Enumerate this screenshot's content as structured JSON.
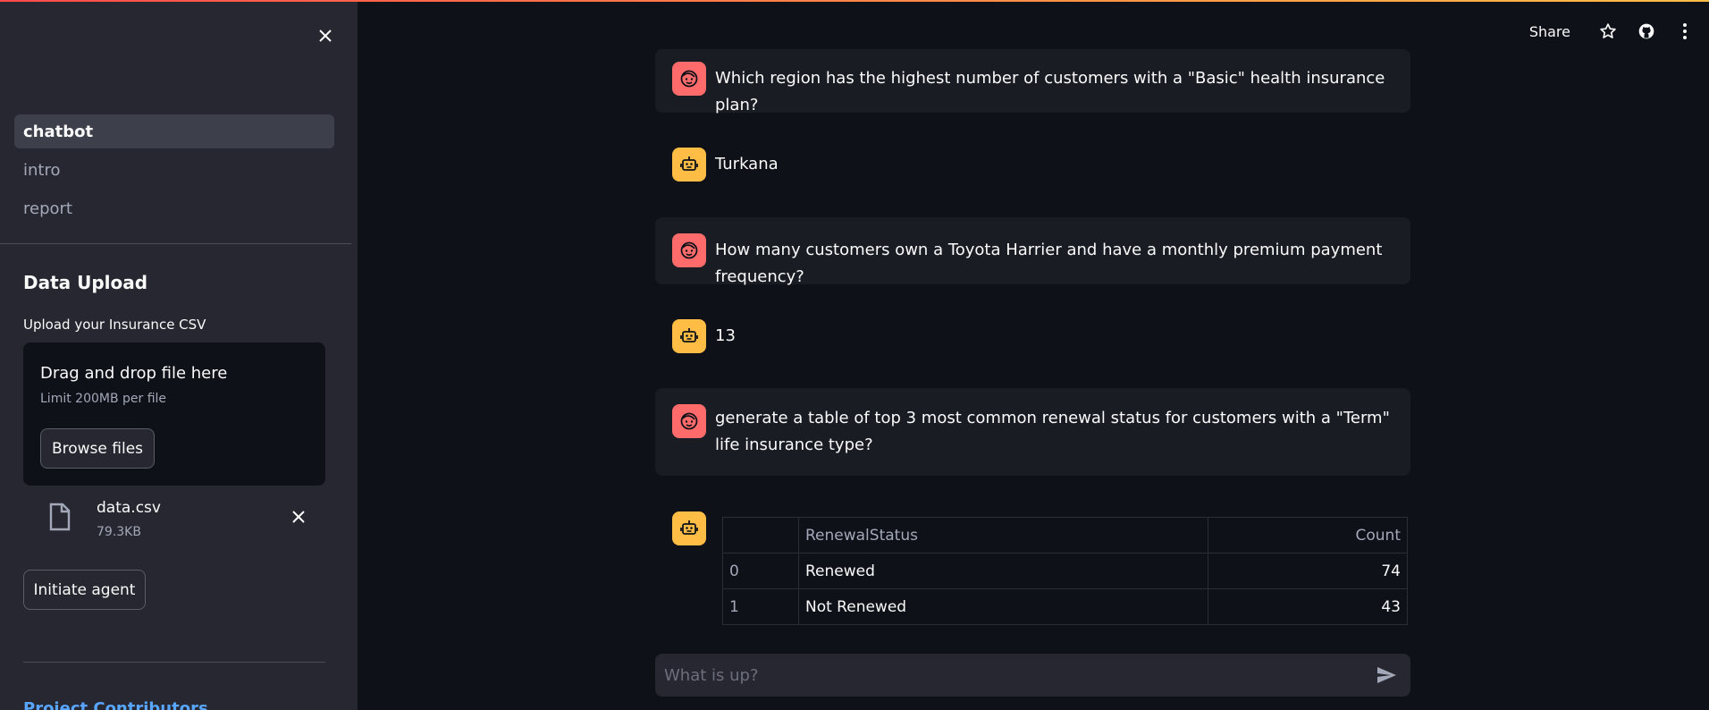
{
  "colors": {
    "accent_start": "#ff4b4b",
    "accent_end": "#ffbd45",
    "user_avatar": "#ff6b6b",
    "bot_avatar": "#ffbd45",
    "link": "#58a6ff"
  },
  "sidebar": {
    "nav": [
      {
        "label": "chatbot",
        "active": true
      },
      {
        "label": "intro"
      },
      {
        "label": "report"
      }
    ],
    "title": "Data Upload",
    "upload_label": "Upload your Insurance CSV",
    "dropzone": {
      "main": "Drag and drop file here",
      "limit": "Limit 200MB per file",
      "browse": "Browse files"
    },
    "file": {
      "name": "data.csv",
      "size": "79.3KB"
    },
    "initiate": "Initiate agent",
    "contributors": "Project Contributors"
  },
  "header": {
    "share": "Share",
    "icons": [
      "star-icon",
      "github-icon",
      "more-icon"
    ]
  },
  "messages": [
    {
      "role": "user",
      "text": "Which region has the highest number of customers with a \"Basic\" health insurance plan?"
    },
    {
      "role": "assistant",
      "text": "Turkana"
    },
    {
      "role": "user",
      "text": "How many customers own a Toyota Harrier and have a monthly premium payment frequency?"
    },
    {
      "role": "assistant",
      "text": "13"
    },
    {
      "role": "user",
      "text": "generate a table of top 3 most common renewal status for customers with a \"Term\" life insurance type?"
    },
    {
      "role": "assistant",
      "table": {
        "columns": [
          "",
          "RenewalStatus",
          "Count"
        ],
        "rows": [
          [
            "0",
            "Renewed",
            "74"
          ],
          [
            "1",
            "Not Renewed",
            "43"
          ]
        ]
      }
    }
  ],
  "chat_input": {
    "placeholder": "What is up?"
  }
}
